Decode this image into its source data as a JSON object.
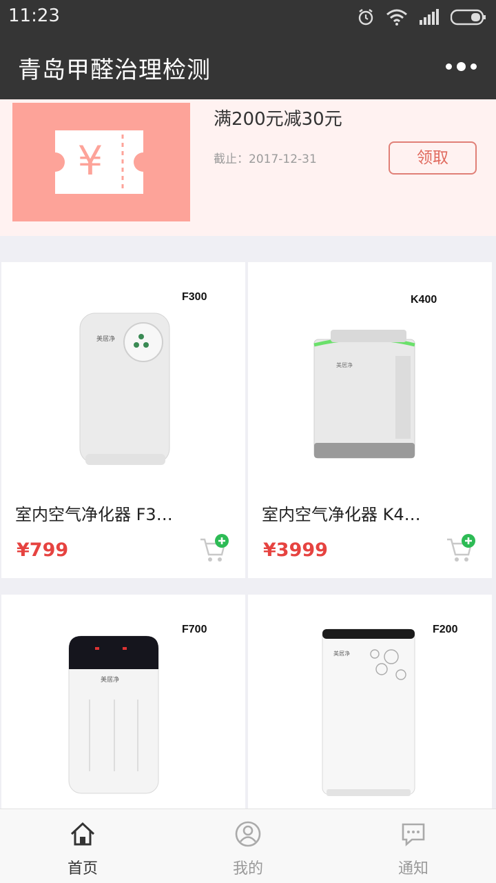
{
  "status_bar": {
    "time": "11:23"
  },
  "nav": {
    "title": "青岛甲醛治理检测"
  },
  "coupon": {
    "title": "满200元减30元",
    "deadline": "截止：2017-12-31",
    "button_label": "领取",
    "symbol": "¥"
  },
  "products": [
    {
      "model": "F300",
      "name": "室内空气净化器 F3…",
      "price": "¥799"
    },
    {
      "model": "K400",
      "name": "室内空气净化器 K4…",
      "price": "¥3999"
    },
    {
      "model": "F700",
      "name": "",
      "price": ""
    },
    {
      "model": "F200",
      "name": "",
      "price": ""
    }
  ],
  "tabs": [
    {
      "label": "首页",
      "icon": "home-icon",
      "active": true
    },
    {
      "label": "我的",
      "icon": "user-icon",
      "active": false
    },
    {
      "label": "通知",
      "icon": "message-icon",
      "active": false
    }
  ],
  "colors": {
    "accent_red": "#e64340",
    "coupon_bg": "#fda399",
    "cart_green": "#2dbb55"
  }
}
